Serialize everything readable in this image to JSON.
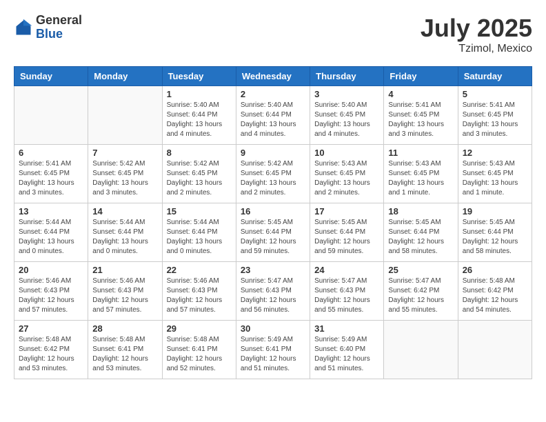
{
  "header": {
    "logo": {
      "general": "General",
      "blue": "Blue"
    },
    "title": "July 2025",
    "location": "Tzimol, Mexico"
  },
  "days_of_week": [
    "Sunday",
    "Monday",
    "Tuesday",
    "Wednesday",
    "Thursday",
    "Friday",
    "Saturday"
  ],
  "weeks": [
    [
      {
        "day": "",
        "info": ""
      },
      {
        "day": "",
        "info": ""
      },
      {
        "day": "1",
        "info": "Sunrise: 5:40 AM\nSunset: 6:44 PM\nDaylight: 13 hours and 4 minutes."
      },
      {
        "day": "2",
        "info": "Sunrise: 5:40 AM\nSunset: 6:44 PM\nDaylight: 13 hours and 4 minutes."
      },
      {
        "day": "3",
        "info": "Sunrise: 5:40 AM\nSunset: 6:45 PM\nDaylight: 13 hours and 4 minutes."
      },
      {
        "day": "4",
        "info": "Sunrise: 5:41 AM\nSunset: 6:45 PM\nDaylight: 13 hours and 3 minutes."
      },
      {
        "day": "5",
        "info": "Sunrise: 5:41 AM\nSunset: 6:45 PM\nDaylight: 13 hours and 3 minutes."
      }
    ],
    [
      {
        "day": "6",
        "info": "Sunrise: 5:41 AM\nSunset: 6:45 PM\nDaylight: 13 hours and 3 minutes."
      },
      {
        "day": "7",
        "info": "Sunrise: 5:42 AM\nSunset: 6:45 PM\nDaylight: 13 hours and 3 minutes."
      },
      {
        "day": "8",
        "info": "Sunrise: 5:42 AM\nSunset: 6:45 PM\nDaylight: 13 hours and 2 minutes."
      },
      {
        "day": "9",
        "info": "Sunrise: 5:42 AM\nSunset: 6:45 PM\nDaylight: 13 hours and 2 minutes."
      },
      {
        "day": "10",
        "info": "Sunrise: 5:43 AM\nSunset: 6:45 PM\nDaylight: 13 hours and 2 minutes."
      },
      {
        "day": "11",
        "info": "Sunrise: 5:43 AM\nSunset: 6:45 PM\nDaylight: 13 hours and 1 minute."
      },
      {
        "day": "12",
        "info": "Sunrise: 5:43 AM\nSunset: 6:45 PM\nDaylight: 13 hours and 1 minute."
      }
    ],
    [
      {
        "day": "13",
        "info": "Sunrise: 5:44 AM\nSunset: 6:44 PM\nDaylight: 13 hours and 0 minutes."
      },
      {
        "day": "14",
        "info": "Sunrise: 5:44 AM\nSunset: 6:44 PM\nDaylight: 13 hours and 0 minutes."
      },
      {
        "day": "15",
        "info": "Sunrise: 5:44 AM\nSunset: 6:44 PM\nDaylight: 13 hours and 0 minutes."
      },
      {
        "day": "16",
        "info": "Sunrise: 5:45 AM\nSunset: 6:44 PM\nDaylight: 12 hours and 59 minutes."
      },
      {
        "day": "17",
        "info": "Sunrise: 5:45 AM\nSunset: 6:44 PM\nDaylight: 12 hours and 59 minutes."
      },
      {
        "day": "18",
        "info": "Sunrise: 5:45 AM\nSunset: 6:44 PM\nDaylight: 12 hours and 58 minutes."
      },
      {
        "day": "19",
        "info": "Sunrise: 5:45 AM\nSunset: 6:44 PM\nDaylight: 12 hours and 58 minutes."
      }
    ],
    [
      {
        "day": "20",
        "info": "Sunrise: 5:46 AM\nSunset: 6:43 PM\nDaylight: 12 hours and 57 minutes."
      },
      {
        "day": "21",
        "info": "Sunrise: 5:46 AM\nSunset: 6:43 PM\nDaylight: 12 hours and 57 minutes."
      },
      {
        "day": "22",
        "info": "Sunrise: 5:46 AM\nSunset: 6:43 PM\nDaylight: 12 hours and 57 minutes."
      },
      {
        "day": "23",
        "info": "Sunrise: 5:47 AM\nSunset: 6:43 PM\nDaylight: 12 hours and 56 minutes."
      },
      {
        "day": "24",
        "info": "Sunrise: 5:47 AM\nSunset: 6:43 PM\nDaylight: 12 hours and 55 minutes."
      },
      {
        "day": "25",
        "info": "Sunrise: 5:47 AM\nSunset: 6:42 PM\nDaylight: 12 hours and 55 minutes."
      },
      {
        "day": "26",
        "info": "Sunrise: 5:48 AM\nSunset: 6:42 PM\nDaylight: 12 hours and 54 minutes."
      }
    ],
    [
      {
        "day": "27",
        "info": "Sunrise: 5:48 AM\nSunset: 6:42 PM\nDaylight: 12 hours and 53 minutes."
      },
      {
        "day": "28",
        "info": "Sunrise: 5:48 AM\nSunset: 6:41 PM\nDaylight: 12 hours and 53 minutes."
      },
      {
        "day": "29",
        "info": "Sunrise: 5:48 AM\nSunset: 6:41 PM\nDaylight: 12 hours and 52 minutes."
      },
      {
        "day": "30",
        "info": "Sunrise: 5:49 AM\nSunset: 6:41 PM\nDaylight: 12 hours and 51 minutes."
      },
      {
        "day": "31",
        "info": "Sunrise: 5:49 AM\nSunset: 6:40 PM\nDaylight: 12 hours and 51 minutes."
      },
      {
        "day": "",
        "info": ""
      },
      {
        "day": "",
        "info": ""
      }
    ]
  ]
}
